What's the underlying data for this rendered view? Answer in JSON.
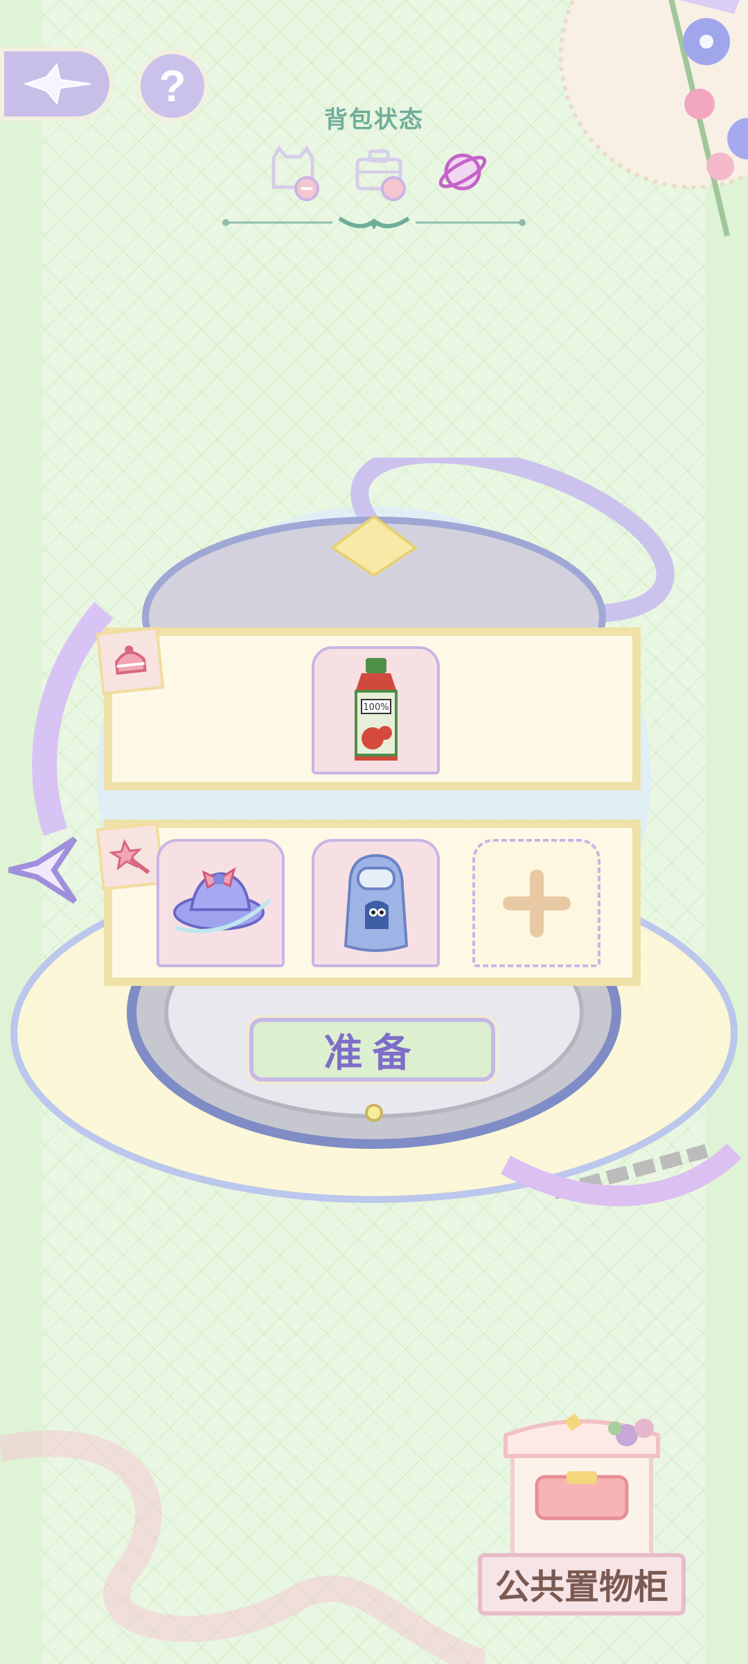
{
  "header": {
    "title": "背包状态"
  },
  "tabs": [
    {
      "icon": "cat-icon"
    },
    {
      "icon": "briefcase-icon"
    },
    {
      "icon": "planet-icon"
    }
  ],
  "rows": [
    {
      "badge_icon": "cake-icon",
      "items": [
        "juice-bottle-icon"
      ]
    },
    {
      "badge_icon": "magic-wand-icon",
      "items": [
        "planet-hat-icon",
        "blue-backpack-icon"
      ],
      "add_slot_icon": "plus-icon"
    }
  ],
  "ready_button": {
    "label": "准备"
  },
  "locker": {
    "label": "公共置物柜"
  },
  "colors": {
    "accent": "#7f6ec8",
    "title": "#6fae9a",
    "panel_border": "#efe1a7",
    "slot_border": "#c9b4e6"
  }
}
